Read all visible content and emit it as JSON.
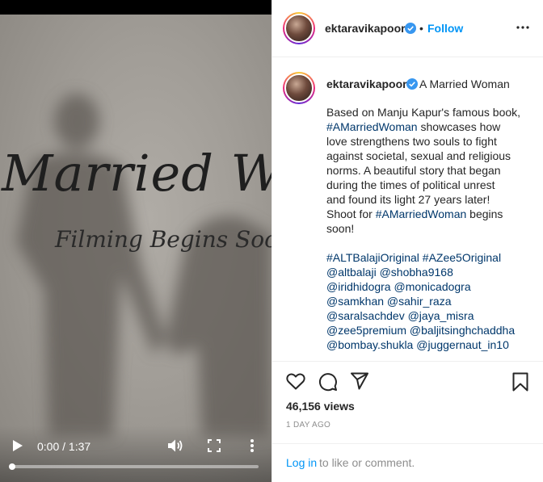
{
  "video": {
    "title_main": "Married Wo",
    "title_sub": "Filming Begins Soon",
    "time": "0:00 / 1:37",
    "progress": 0
  },
  "header": {
    "username": "ektaravikapoor",
    "separator": "•",
    "follow_label": "Follow"
  },
  "caption": {
    "username": "ektaravikapoor",
    "title": "A Married Woman",
    "lines": [
      [
        {
          "t": "Based on Manju Kapur's famous book,",
          "tag": false
        }
      ],
      [
        {
          "t": "#AMarriedWoman",
          "tag": true
        },
        {
          "t": " showcases how",
          "tag": false
        }
      ],
      [
        {
          "t": "love strengthens two souls to fight",
          "tag": false
        }
      ],
      [
        {
          "t": "against societal, sexual and religious",
          "tag": false
        }
      ],
      [
        {
          "t": "norms. A beautiful story that began",
          "tag": false
        }
      ],
      [
        {
          "t": "during the times of political unrest",
          "tag": false
        }
      ],
      [
        {
          "t": "and found its light 27 years later!",
          "tag": false
        }
      ],
      [
        {
          "t": "Shoot for ",
          "tag": false
        },
        {
          "t": "#AMarriedWoman",
          "tag": true
        },
        {
          "t": " begins",
          "tag": false
        }
      ],
      [
        {
          "t": "soon!",
          "tag": false
        }
      ]
    ],
    "tag_lines": [
      [
        {
          "t": "#ALTBalajiOriginal",
          "tag": true
        },
        {
          "t": " ",
          "tag": false
        },
        {
          "t": "#AZee5Original",
          "tag": true
        }
      ],
      [
        {
          "t": "@altbalaji",
          "tag": true
        },
        {
          "t": " ",
          "tag": false
        },
        {
          "t": "@shobha9168",
          "tag": true
        }
      ],
      [
        {
          "t": "@iridhidogra",
          "tag": true
        },
        {
          "t": " ",
          "tag": false
        },
        {
          "t": "@monicadogra",
          "tag": true
        }
      ],
      [
        {
          "t": "@samkhan",
          "tag": true
        },
        {
          "t": " ",
          "tag": false
        },
        {
          "t": "@sahir_raza",
          "tag": true
        }
      ],
      [
        {
          "t": "@saralsachdev",
          "tag": true
        },
        {
          "t": " ",
          "tag": false
        },
        {
          "t": "@jaya_misra",
          "tag": true
        }
      ],
      [
        {
          "t": "@zee5premium",
          "tag": true
        },
        {
          "t": " ",
          "tag": false
        },
        {
          "t": "@baljitsinghchaddha",
          "tag": true
        }
      ],
      [
        {
          "t": "@bombay.shukla",
          "tag": true
        },
        {
          "t": " ",
          "tag": false
        },
        {
          "t": "@juggernaut_in10",
          "tag": true
        }
      ]
    ]
  },
  "stats": {
    "views": "46,156 views",
    "age": "1 DAY AGO"
  },
  "login": {
    "link_label": "Log in",
    "rest": " to like or comment."
  },
  "colors": {
    "link_blue": "#0095f6",
    "tag_blue": "#00376b",
    "muted": "#8e8e8e",
    "border": "#efefef"
  },
  "icons": [
    "play-icon",
    "volume-icon",
    "fullscreen-icon",
    "more-vertical-icon",
    "verified-icon",
    "more-horizontal-icon",
    "heart-icon",
    "comment-icon",
    "share-icon",
    "bookmark-icon"
  ]
}
